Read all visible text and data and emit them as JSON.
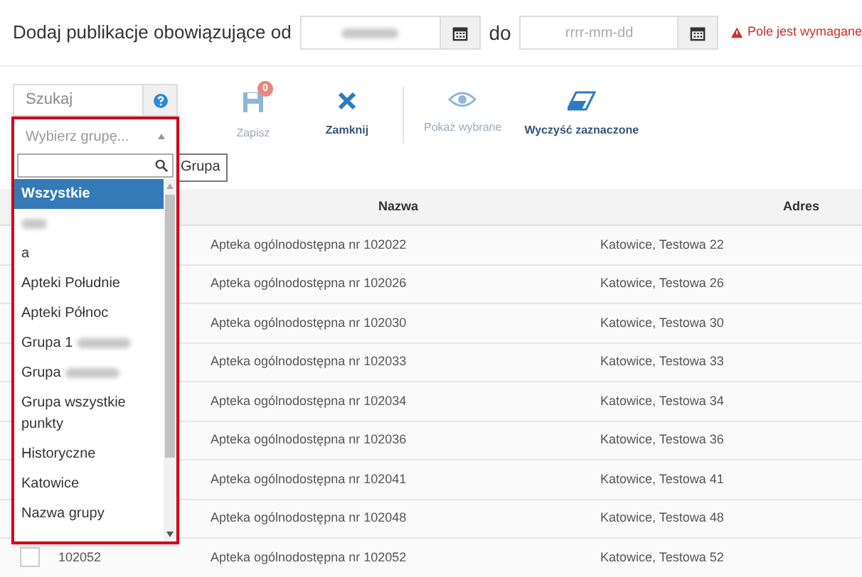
{
  "header": {
    "label": "Dodaj publikacje obowiązujące od",
    "date_from": {
      "redacted": true
    },
    "separator": "do",
    "date_to": {
      "placeholder": "rrrr-mm-dd"
    },
    "error": "Pole jest wymagane"
  },
  "search": {
    "placeholder": "Szukaj"
  },
  "toolbar": [
    {
      "kind": "save",
      "label": "Zapisz",
      "badge": "0",
      "disabled": true
    },
    {
      "kind": "close",
      "label": "Zamknij",
      "disabled": false
    },
    {
      "kind": "show",
      "label": "Pokaż wybrane",
      "disabled": true
    },
    {
      "kind": "clear",
      "label": "Wyczyść zaznaczone",
      "disabled": false
    }
  ],
  "group_button": "Grupa",
  "group_dropdown": {
    "placeholder": "Wybierz grupę...",
    "items": [
      {
        "label": "Wszystkie",
        "selected": true
      },
      {
        "redacted": true,
        "selected": false
      },
      {
        "label": "a",
        "selected": false
      },
      {
        "label": "Apteki Południe",
        "selected": false
      },
      {
        "label": "Apteki Północ",
        "selected": false
      },
      {
        "label": "Grupa 1",
        "redacted": true,
        "selected": false
      },
      {
        "label": "Grupa",
        "redacted": true,
        "selected": false
      },
      {
        "label": "Grupa wszystkie punkty",
        "selected": false
      },
      {
        "label": "Historyczne",
        "selected": false
      },
      {
        "label": "Katowice",
        "selected": false
      },
      {
        "label": "Nazwa grupy",
        "selected": false
      }
    ]
  },
  "table": {
    "columns": [
      "Nazwa",
      "Adres"
    ],
    "rows": [
      {
        "name": "Apteka ogólnodostępna nr 102022",
        "address": "Katowice, Testowa 22"
      },
      {
        "name": "Apteka ogólnodostępna nr 102026",
        "address": "Katowice, Testowa 26"
      },
      {
        "name": "Apteka ogólnodostępna nr 102030",
        "address": "Katowice, Testowa 30"
      },
      {
        "name": "Apteka ogólnodostępna nr 102033",
        "address": "Katowice, Testowa 33"
      },
      {
        "name": "Apteka ogólnodostępna nr 102034",
        "address": "Katowice, Testowa 34"
      },
      {
        "name": "Apteka ogólnodostępna nr 102036",
        "address": "Katowice, Testowa 36"
      },
      {
        "name": "Apteka ogólnodostępna nr 102041",
        "address": "Katowice, Testowa 41"
      },
      {
        "name": "Apteka ogólnodostępna nr 102048",
        "address": "Katowice, Testowa 48"
      },
      {
        "number": "102052",
        "checked": false,
        "name": "Apteka ogólnodostępna nr 102052",
        "address": "Katowice, Testowa 52"
      }
    ]
  }
}
